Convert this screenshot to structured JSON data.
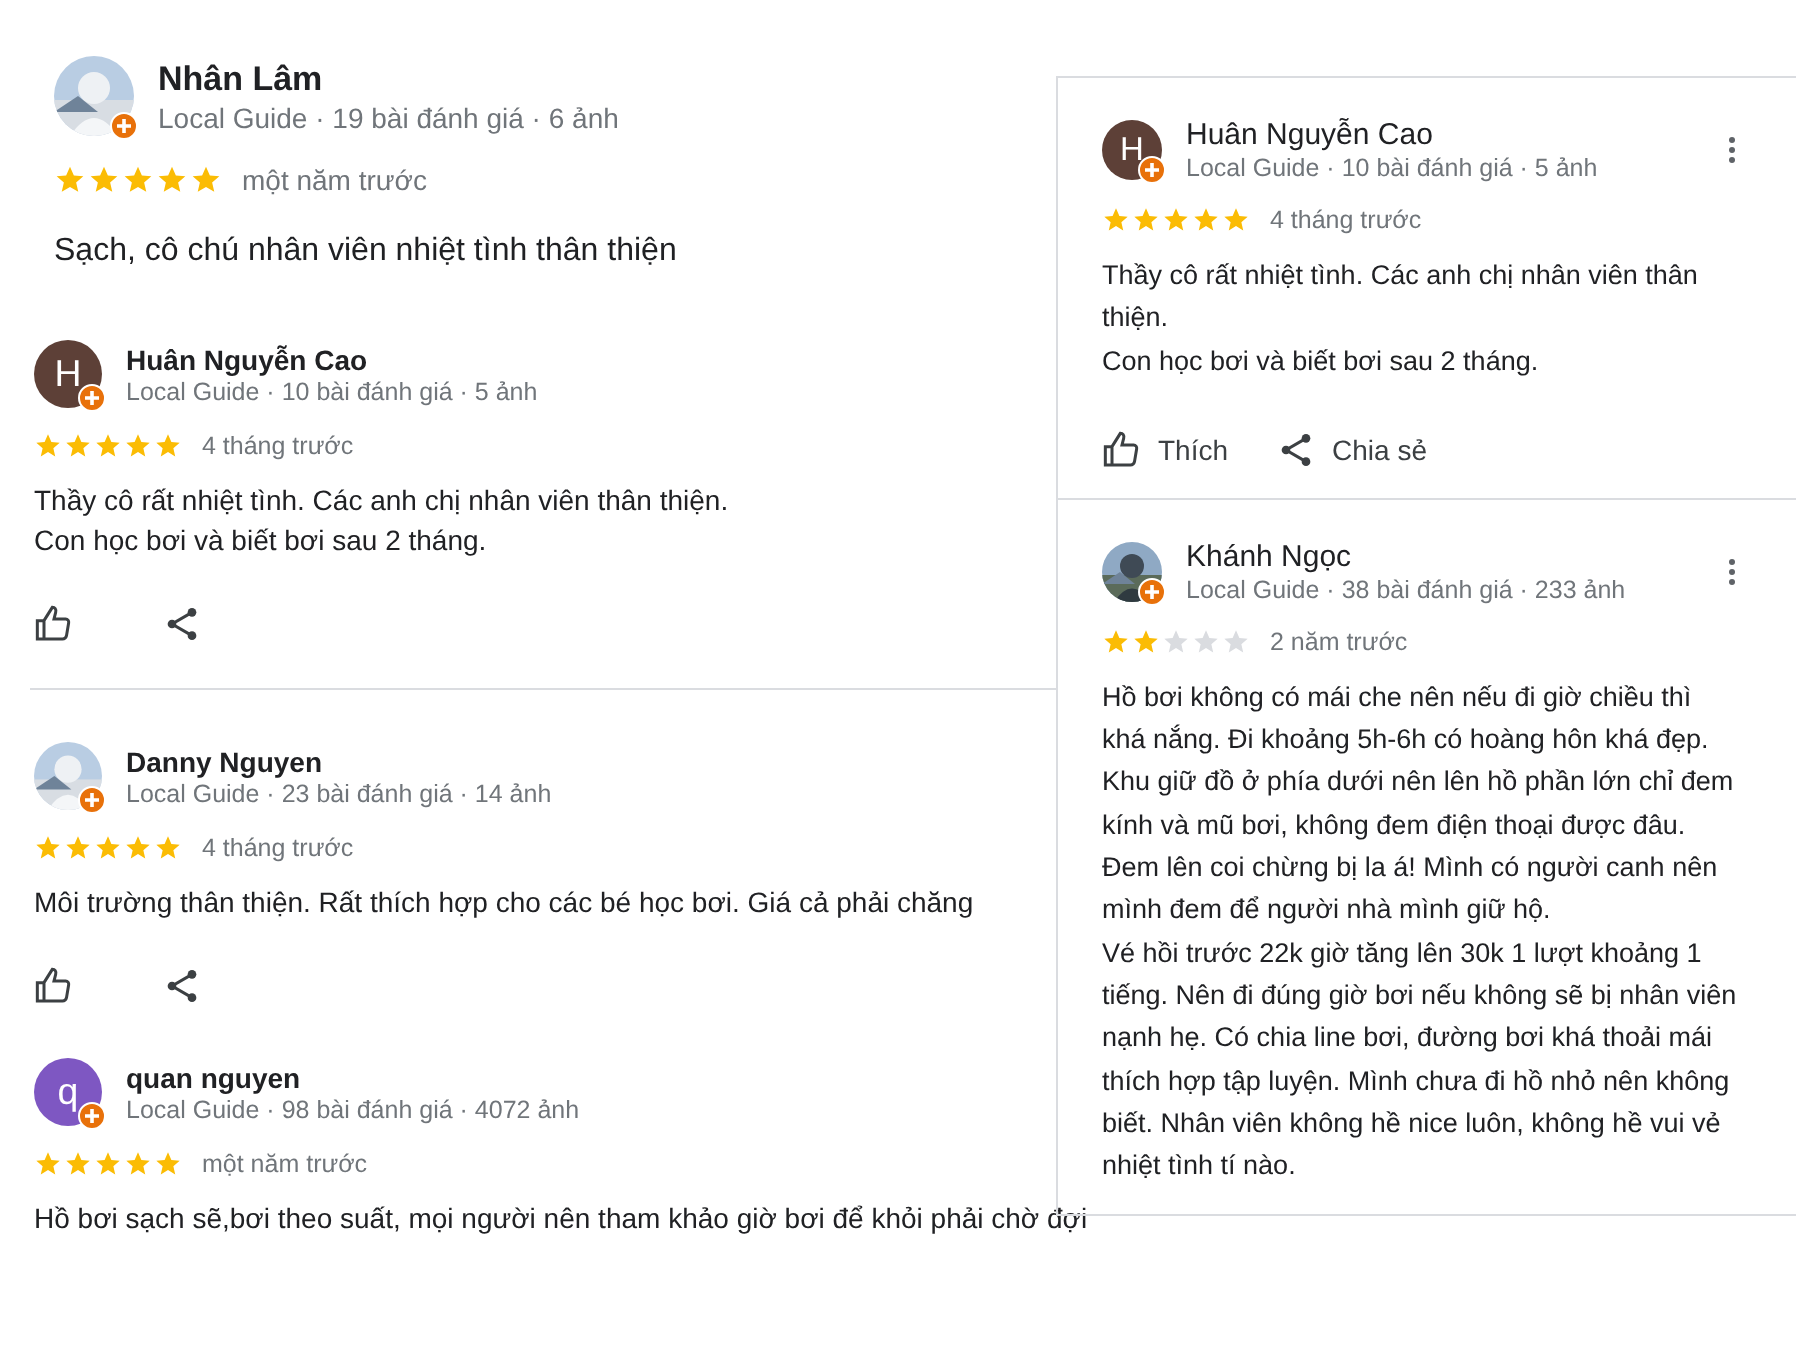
{
  "left_reviews": [
    {
      "avatar": {
        "kind": "picture"
      },
      "name": "Nhân Lâm",
      "meta": "Local Guide · 19 bài đánh giá · 6 ảnh",
      "stars": 5,
      "time": "một năm trước",
      "lines": [
        "Sạch, cô chú nhân viên nhiệt tình thân thiện"
      ]
    },
    {
      "avatar": {
        "kind": "letter",
        "letter": "H",
        "color": "#5d4037"
      },
      "name": "Huân Nguyễn Cao",
      "meta": "Local Guide · 10 bài đánh giá · 5 ảnh",
      "stars": 5,
      "time": "4 tháng trước",
      "lines": [
        "Thầy cô rất nhiệt tình. Các anh chị nhân viên thân thiện.",
        "Con học bơi và biết bơi sau 2 tháng."
      ],
      "actions": [
        {
          "kind": "like"
        },
        {
          "kind": "share"
        }
      ],
      "separated": true
    },
    {
      "avatar": {
        "kind": "picture"
      },
      "name": "Danny Nguyen",
      "meta": "Local Guide · 23 bài đánh giá · 14 ảnh",
      "stars": 5,
      "time": "4 tháng trước",
      "lines": [
        "Môi trường thân thiện. Rất thích hợp cho các bé học bơi. Giá cả phải chăng"
      ],
      "actions": [
        {
          "kind": "like"
        },
        {
          "kind": "share"
        }
      ]
    },
    {
      "avatar": {
        "kind": "letter",
        "letter": "q",
        "color": "#7e57c2"
      },
      "name": "quan nguyen",
      "meta": "Local Guide · 98 bài đánh giá · 4072 ảnh",
      "stars": 5,
      "time": "một năm trước",
      "lines": [
        "Hồ bơi sạch sẽ,bơi theo suất, mọi người nên tham khảo giờ bơi để khỏi phải chờ đợi"
      ]
    }
  ],
  "right_panel": {
    "reviews": [
      {
        "avatar": {
          "kind": "letter",
          "letter": "H",
          "color": "#5d4037"
        },
        "name": "Huân Nguyễn Cao",
        "meta": "Local Guide · 10 bài đánh giá · 5 ảnh",
        "stars": 5,
        "time": "4 tháng trước",
        "lines": [
          "Thầy cô rất nhiệt tình. Các anh chị nhân viên thân thiện.",
          "Con học bơi và biết bơi sau 2 tháng."
        ],
        "actions": [
          {
            "kind": "like",
            "label": "Thích"
          },
          {
            "kind": "share",
            "label": "Chia sẻ"
          }
        ]
      },
      {
        "avatar": {
          "kind": "picture"
        },
        "name": "Khánh Ngọc",
        "meta": "Local Guide · 38 bài đánh giá · 233 ảnh",
        "stars": 2,
        "time": "2 năm trước",
        "lines": [
          "Hồ bơi không có mái che nên nếu đi giờ chiều thì khá nắng. Đi khoảng 5h-6h có hoàng hôn khá đẹp. Khu giữ đồ ở phía dưới nên lên hồ phần lớn chỉ đem kính và mũ bơi, không đem điện thoại được đâu. Đem lên coi chừng bị la á! Mình có người canh nên mình đem để người nhà mình giữ hộ.",
          "Vé hồi trước 22k giờ tăng lên 30k 1 lượt khoảng 1 tiếng. Nên đi đúng giờ bơi nếu không sẽ bị nhân viên nạnh hẹ. Có chia line bơi, đường bơi khá thoải mái thích hợp tập luyện. Mình chưa đi hồ nhỏ nên không biết. Nhân viên không hề nice luôn, không hề vui vẻ nhiệt tình tí nào."
        ]
      }
    ]
  }
}
